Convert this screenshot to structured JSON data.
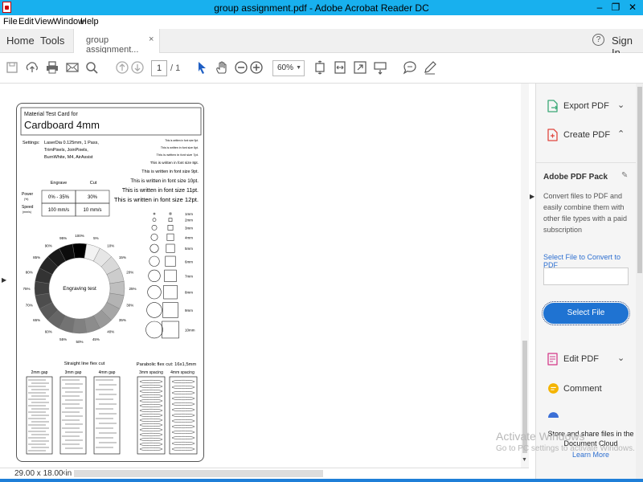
{
  "window": {
    "title": "group assignment.pdf - Adobe Acrobat Reader DC",
    "minimize": "–",
    "restore": "❐",
    "close": "✕"
  },
  "menu": [
    "File",
    "Edit",
    "View",
    "Window",
    "Help"
  ],
  "tabs": {
    "home": "Home",
    "tools": "Tools",
    "document": "group assignment...",
    "close": "×",
    "help": "?",
    "sign_in": "Sign In"
  },
  "toolbar": {
    "page_current": "1",
    "page_total": "/ 1",
    "zoom": "60%",
    "icons": [
      "save-icon",
      "upload-icon",
      "print-icon",
      "mail-icon",
      "search-icon",
      "page-up-icon",
      "page-down-icon",
      "select-arrow-icon",
      "hand-icon",
      "zoom-out-icon",
      "zoom-in-icon",
      "fit-page-icon",
      "fit-width-icon",
      "fullscreen-icon",
      "read-mode-icon",
      "comment-icon",
      "pen-icon"
    ]
  },
  "document": {
    "header_small": "Material Test Card for",
    "header_large": "Cardboard 4mm",
    "settings_label": "Settings:",
    "settings_lines": [
      "LaserDia 0.125mm, 1 Pass,",
      "TrimPixels, JoinPixels,",
      "BurnWhite, M4, AirAssist"
    ],
    "font_sizes": [
      "This is written in font size 5pt.",
      "This is written in font size 6pt.",
      "This is written in font size 7pt.",
      "This is written in font size 8pt.",
      "This is written in font size 9pt.",
      "This is written in font size 10pt.",
      "This is written in font size 11pt.",
      "This is written in font size 12pt."
    ],
    "table": {
      "col_engrave": "Engrave",
      "col_cut": "Cut",
      "row_power": "Power",
      "row_power_unit": "(%)",
      "row_speed": "Speed",
      "row_speed_unit": "(mm/s)",
      "power_engrave": "0% - 35%",
      "power_cut": "30%",
      "speed_engrave": "100 mm/s",
      "speed_cut": "10 mm/s"
    },
    "wheel_center": "Engraving test",
    "wheel_labels": [
      "100%",
      "5%",
      "10%",
      "15%",
      "20%",
      "25%",
      "30%",
      "35%",
      "40%",
      "45%",
      "50%",
      "55%",
      "60%",
      "65%",
      "70%",
      "75%",
      "80%",
      "85%",
      "90%",
      "95%"
    ],
    "shape_sizes": [
      "1mm",
      "2mm",
      "3mm",
      "4mm",
      "5mm",
      "6mm",
      "7mm",
      "8mm",
      "9mm",
      "10mm"
    ],
    "flex_straight_title": "Straight line flex cut",
    "flex_straight_gaps": [
      "2mm gap",
      "3mm gap",
      "4mm gap"
    ],
    "flex_parabolic_title": "Parabolic flex cut: 16x1,5mm",
    "flex_parabolic_spacing": [
      "3mm spacing",
      "4mm spacing"
    ]
  },
  "status": {
    "dimensions": "29.00 x 18.00 in"
  },
  "panel": {
    "export_pdf": "Export PDF",
    "create_pdf": "Create PDF",
    "pack_title": "Adobe PDF Pack",
    "pack_desc": "Convert files to PDF and easily combine them with other file types with a paid subscription",
    "select_link": "Select File to Convert to PDF",
    "select_button": "Select File",
    "edit_pdf": "Edit PDF",
    "comment": "Comment",
    "store_line1": "Store and share files in the",
    "store_line2": "Document Cloud",
    "learn_more": "Learn More"
  },
  "watermark": {
    "line1": "Activate Windows",
    "line2": "Go to PC settings to activate Windows."
  },
  "colors": {
    "titlebar": "#18b0ee",
    "accent_blue": "#1f73d2",
    "export_icon": "#3aa876",
    "create_icon": "#e0463e",
    "edit_icon": "#d43c8a",
    "comment_icon": "#f4b400"
  }
}
